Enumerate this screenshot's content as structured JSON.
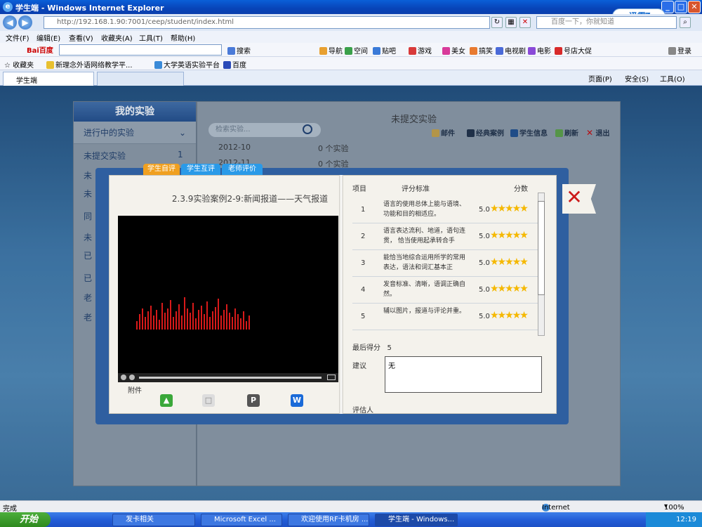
{
  "window": {
    "title": "学生端 - Windows Internet Explorer",
    "minimize_icon": "minimize-icon",
    "maximize_icon": "maximize-icon",
    "close_icon": "close-icon",
    "badge": "迅雷7"
  },
  "address": {
    "url": "http://192.168.1.90:7001/ceep/student/index.html",
    "search_placeholder": "百度一下，你就知道"
  },
  "menu": [
    "文件(F)",
    "编辑(E)",
    "查看(V)",
    "收藏夹(A)",
    "工具(T)",
    "帮助(H)"
  ],
  "toolbar": {
    "brand": "Bai百度",
    "search_label": "搜索",
    "items": [
      "导航",
      "空间",
      "贴吧",
      "游戏",
      "美女",
      "搞笑",
      "电视剧",
      "电影",
      "号店大促"
    ],
    "login": "登录"
  },
  "favorites": {
    "label": "收藏夹",
    "items": [
      "新理念外语网络教学平...",
      "大学英语实验平台",
      "百度"
    ]
  },
  "tabs": {
    "current": "学生端",
    "tools": [
      "页面(P)",
      "安全(S)",
      "工具(O)"
    ]
  },
  "sidebar": {
    "title": "我的实验",
    "section": "进行中的实验",
    "items": [
      {
        "label": "未提交实验",
        "count": "1"
      },
      {
        "label": "未",
        "count": ""
      },
      {
        "label": "未",
        "count": ""
      },
      {
        "label": "同",
        "count": ""
      },
      {
        "label": "未",
        "count": ""
      },
      {
        "label": "已",
        "count": ""
      },
      {
        "label": "已",
        "count": ""
      },
      {
        "label": "老",
        "count": ""
      },
      {
        "label": "老",
        "count": ""
      }
    ]
  },
  "main": {
    "title": "未提交实验",
    "search_placeholder": "检索实验...",
    "tools": [
      "邮件",
      "经典案例",
      "学生信息",
      "刷新",
      "退出"
    ],
    "rows": [
      {
        "month": "2012-10",
        "count": "0 个实验"
      },
      {
        "month": "2012-11",
        "count": "0 个实验"
      }
    ]
  },
  "modal": {
    "tabs": [
      "学生自评",
      "学生互评",
      "老师评价"
    ],
    "title": "2.3.9实验案例2-9:新闻报道——天气报道",
    "attachments_label": "附件",
    "table_headers": [
      "项目",
      "评分标准",
      "分数"
    ],
    "scores": [
      {
        "id": "1",
        "criterion": "语言的使用总体上能与语境、功能和目的相适应。",
        "score": "5.0",
        "stars": 5
      },
      {
        "id": "2",
        "criterion": "语言表达流利、地道，语句连贯， 恰当使用起承转合手",
        "score": "5.0",
        "stars": 5
      },
      {
        "id": "3",
        "criterion": "能恰当地综合运用所学的常用表达，语法和词汇基本正",
        "score": "5.0",
        "stars": 5
      },
      {
        "id": "4",
        "criterion": "发音标准、清晰，语调正确自然。",
        "score": "5.0",
        "stars": 5
      },
      {
        "id": "5",
        "criterion": "辅以图片，报道与评论并重。",
        "score": "5.0",
        "stars": 5
      },
      {
        "id": "",
        "criterion": "",
        "score": "",
        "stars": 0
      }
    ],
    "final_label": "最后得分",
    "final_score": "5",
    "suggestion_label": "建议",
    "suggestion_value": "无",
    "evaluator_label": "评估人"
  },
  "statusbar": {
    "left": "完成",
    "zone": "Internet",
    "zoom": "100%"
  },
  "taskbar": {
    "start": "开始",
    "tasks": [
      "发卡相关",
      "Microsoft Excel ...",
      "欢迎使用RF卡机房 ...",
      "学生端 - Windows..."
    ],
    "time": "12:19"
  },
  "colors": {
    "titlebar": "#0a5fd8",
    "modal_frame": "#2f5fa0",
    "tab_self": "#f0a020",
    "tab_peer": "#2a9ae8",
    "tab_teacher": "#2a9ae8",
    "close_x": "#cc1a1a",
    "star": "#f5b800"
  }
}
